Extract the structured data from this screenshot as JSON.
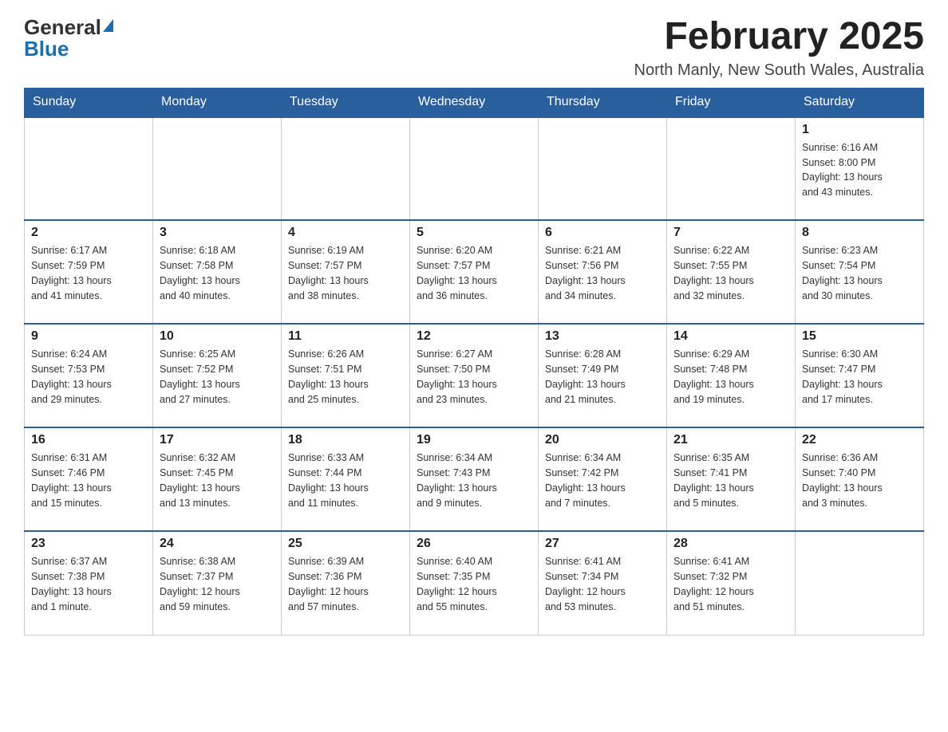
{
  "logo": {
    "general": "General",
    "blue": "Blue"
  },
  "title": "February 2025",
  "subtitle": "North Manly, New South Wales, Australia",
  "weekdays": [
    "Sunday",
    "Monday",
    "Tuesday",
    "Wednesday",
    "Thursday",
    "Friday",
    "Saturday"
  ],
  "weeks": [
    [
      {
        "day": "",
        "info": ""
      },
      {
        "day": "",
        "info": ""
      },
      {
        "day": "",
        "info": ""
      },
      {
        "day": "",
        "info": ""
      },
      {
        "day": "",
        "info": ""
      },
      {
        "day": "",
        "info": ""
      },
      {
        "day": "1",
        "info": "Sunrise: 6:16 AM\nSunset: 8:00 PM\nDaylight: 13 hours\nand 43 minutes."
      }
    ],
    [
      {
        "day": "2",
        "info": "Sunrise: 6:17 AM\nSunset: 7:59 PM\nDaylight: 13 hours\nand 41 minutes."
      },
      {
        "day": "3",
        "info": "Sunrise: 6:18 AM\nSunset: 7:58 PM\nDaylight: 13 hours\nand 40 minutes."
      },
      {
        "day": "4",
        "info": "Sunrise: 6:19 AM\nSunset: 7:57 PM\nDaylight: 13 hours\nand 38 minutes."
      },
      {
        "day": "5",
        "info": "Sunrise: 6:20 AM\nSunset: 7:57 PM\nDaylight: 13 hours\nand 36 minutes."
      },
      {
        "day": "6",
        "info": "Sunrise: 6:21 AM\nSunset: 7:56 PM\nDaylight: 13 hours\nand 34 minutes."
      },
      {
        "day": "7",
        "info": "Sunrise: 6:22 AM\nSunset: 7:55 PM\nDaylight: 13 hours\nand 32 minutes."
      },
      {
        "day": "8",
        "info": "Sunrise: 6:23 AM\nSunset: 7:54 PM\nDaylight: 13 hours\nand 30 minutes."
      }
    ],
    [
      {
        "day": "9",
        "info": "Sunrise: 6:24 AM\nSunset: 7:53 PM\nDaylight: 13 hours\nand 29 minutes."
      },
      {
        "day": "10",
        "info": "Sunrise: 6:25 AM\nSunset: 7:52 PM\nDaylight: 13 hours\nand 27 minutes."
      },
      {
        "day": "11",
        "info": "Sunrise: 6:26 AM\nSunset: 7:51 PM\nDaylight: 13 hours\nand 25 minutes."
      },
      {
        "day": "12",
        "info": "Sunrise: 6:27 AM\nSunset: 7:50 PM\nDaylight: 13 hours\nand 23 minutes."
      },
      {
        "day": "13",
        "info": "Sunrise: 6:28 AM\nSunset: 7:49 PM\nDaylight: 13 hours\nand 21 minutes."
      },
      {
        "day": "14",
        "info": "Sunrise: 6:29 AM\nSunset: 7:48 PM\nDaylight: 13 hours\nand 19 minutes."
      },
      {
        "day": "15",
        "info": "Sunrise: 6:30 AM\nSunset: 7:47 PM\nDaylight: 13 hours\nand 17 minutes."
      }
    ],
    [
      {
        "day": "16",
        "info": "Sunrise: 6:31 AM\nSunset: 7:46 PM\nDaylight: 13 hours\nand 15 minutes."
      },
      {
        "day": "17",
        "info": "Sunrise: 6:32 AM\nSunset: 7:45 PM\nDaylight: 13 hours\nand 13 minutes."
      },
      {
        "day": "18",
        "info": "Sunrise: 6:33 AM\nSunset: 7:44 PM\nDaylight: 13 hours\nand 11 minutes."
      },
      {
        "day": "19",
        "info": "Sunrise: 6:34 AM\nSunset: 7:43 PM\nDaylight: 13 hours\nand 9 minutes."
      },
      {
        "day": "20",
        "info": "Sunrise: 6:34 AM\nSunset: 7:42 PM\nDaylight: 13 hours\nand 7 minutes."
      },
      {
        "day": "21",
        "info": "Sunrise: 6:35 AM\nSunset: 7:41 PM\nDaylight: 13 hours\nand 5 minutes."
      },
      {
        "day": "22",
        "info": "Sunrise: 6:36 AM\nSunset: 7:40 PM\nDaylight: 13 hours\nand 3 minutes."
      }
    ],
    [
      {
        "day": "23",
        "info": "Sunrise: 6:37 AM\nSunset: 7:38 PM\nDaylight: 13 hours\nand 1 minute."
      },
      {
        "day": "24",
        "info": "Sunrise: 6:38 AM\nSunset: 7:37 PM\nDaylight: 12 hours\nand 59 minutes."
      },
      {
        "day": "25",
        "info": "Sunrise: 6:39 AM\nSunset: 7:36 PM\nDaylight: 12 hours\nand 57 minutes."
      },
      {
        "day": "26",
        "info": "Sunrise: 6:40 AM\nSunset: 7:35 PM\nDaylight: 12 hours\nand 55 minutes."
      },
      {
        "day": "27",
        "info": "Sunrise: 6:41 AM\nSunset: 7:34 PM\nDaylight: 12 hours\nand 53 minutes."
      },
      {
        "day": "28",
        "info": "Sunrise: 6:41 AM\nSunset: 7:32 PM\nDaylight: 12 hours\nand 51 minutes."
      },
      {
        "day": "",
        "info": ""
      }
    ]
  ]
}
